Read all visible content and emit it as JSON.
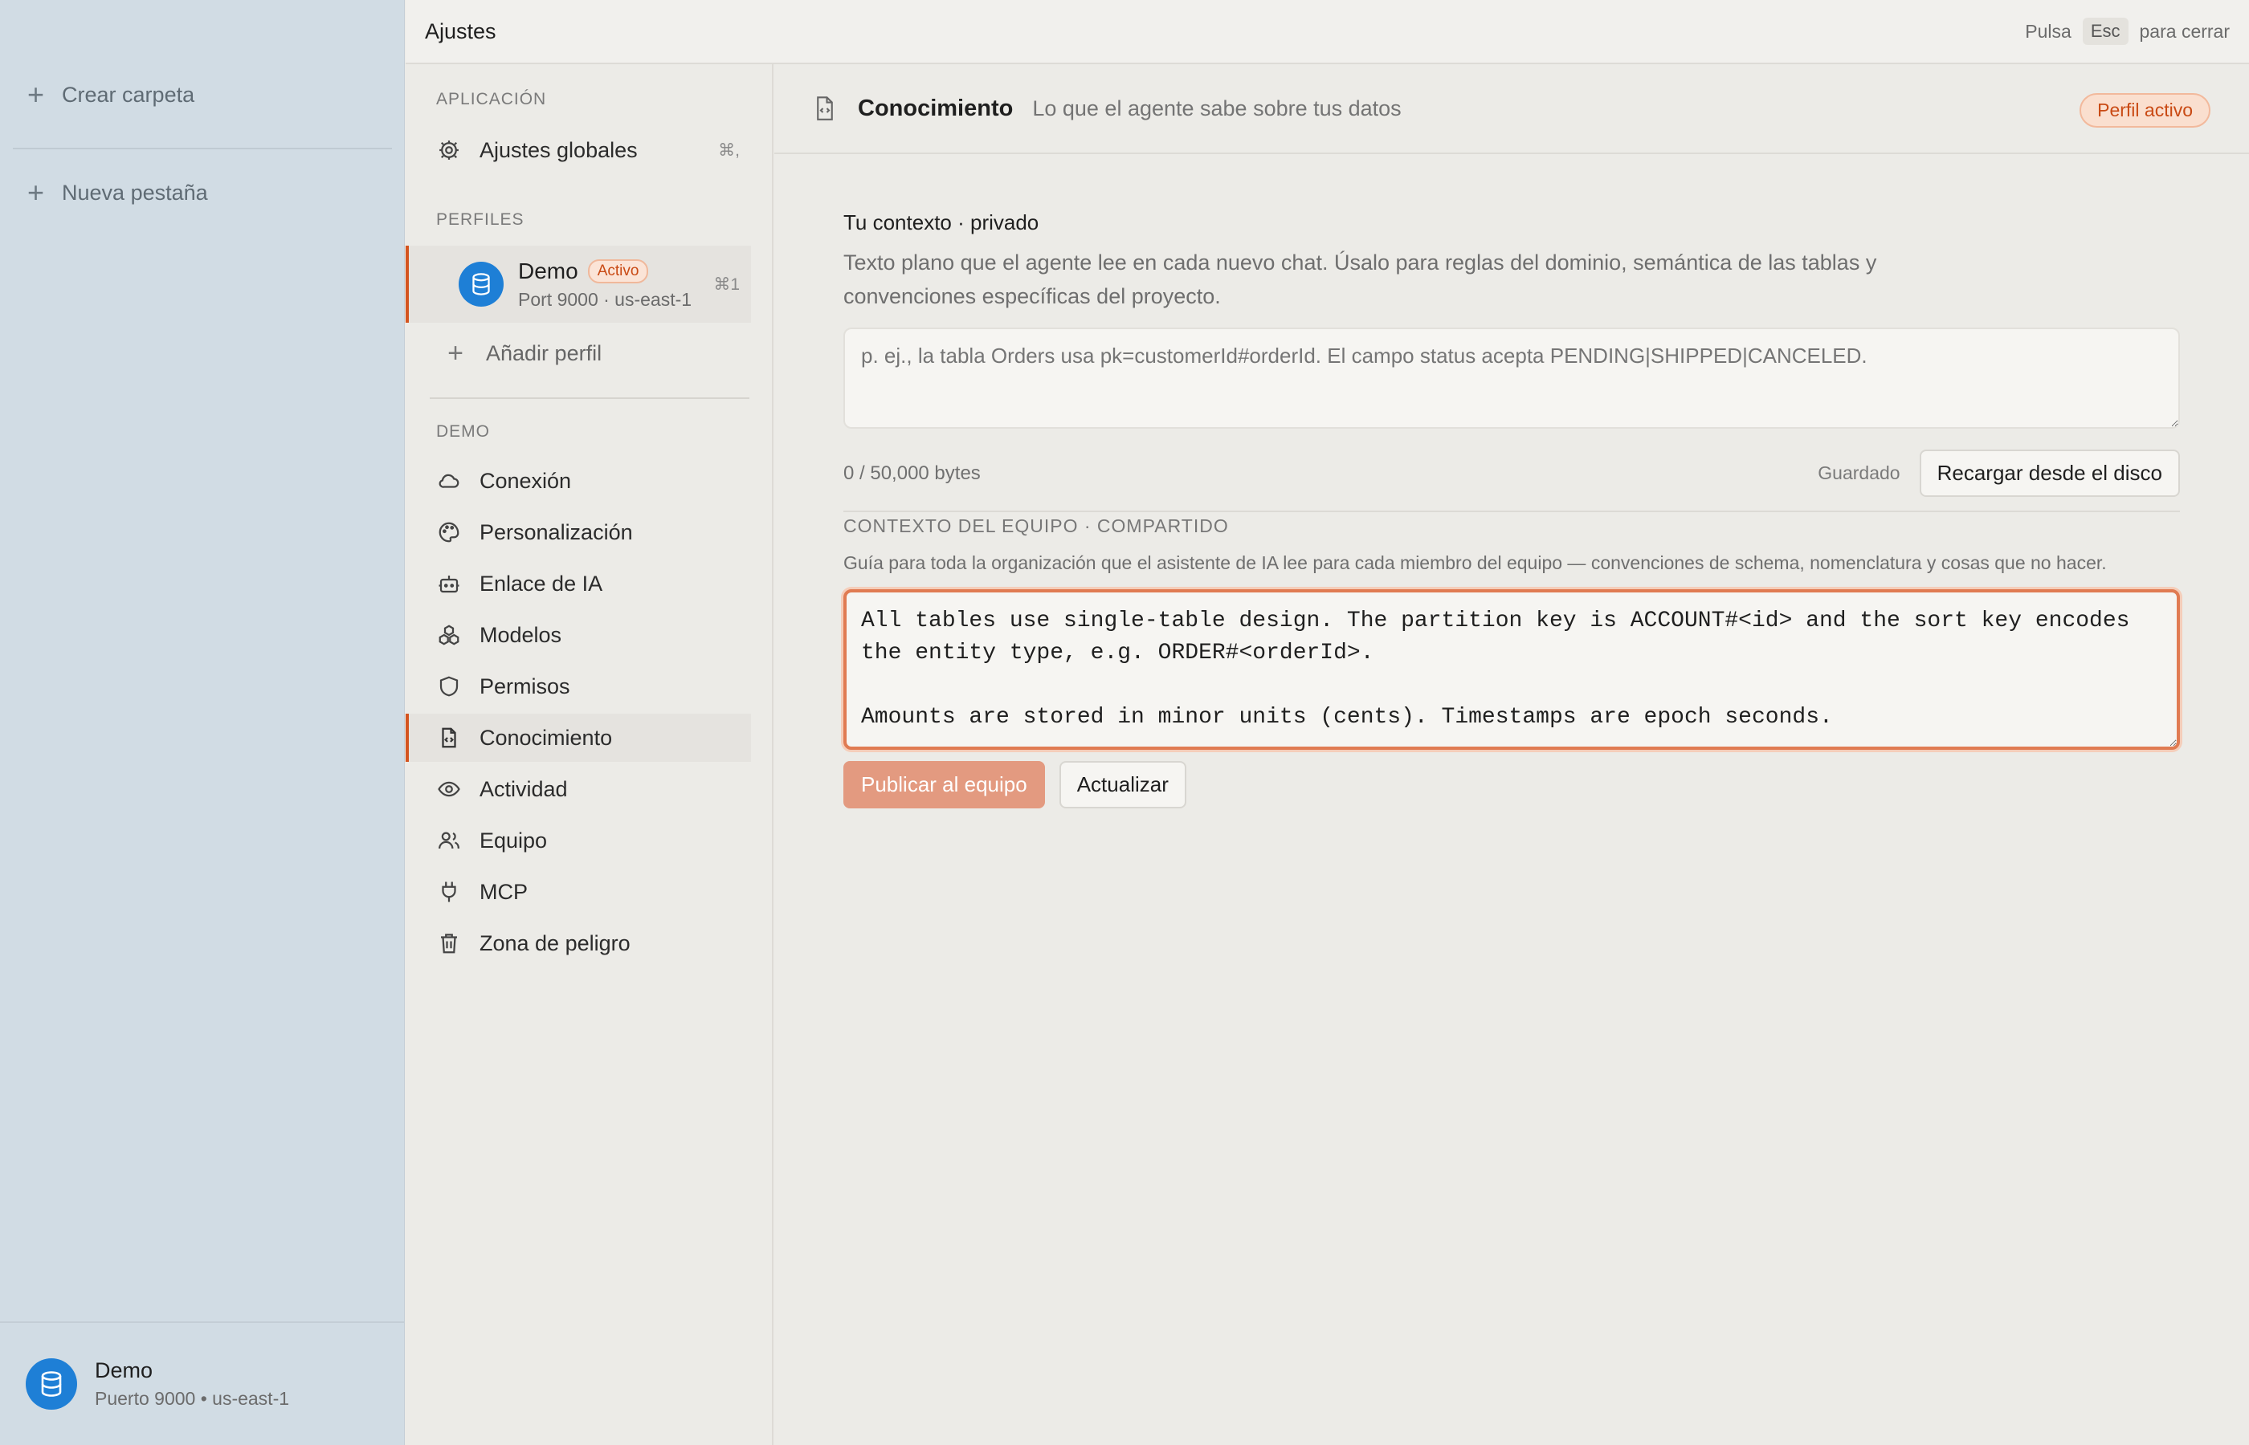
{
  "app_sidebar": {
    "create_folder": "Crear carpeta",
    "new_tab": "Nueva pestaña",
    "footer": {
      "name": "Demo",
      "sub": "Puerto 9000 • us-east-1"
    }
  },
  "topbar": {
    "title": "Ajustes",
    "hint_prefix": "Pulsa",
    "hint_key": "Esc",
    "hint_suffix": "para cerrar"
  },
  "nav": {
    "section_app": "APLICACIÓN",
    "global_settings": {
      "label": "Ajustes globales",
      "shortcut": "⌘,"
    },
    "section_profiles": "PERFILES",
    "profile": {
      "name": "Demo",
      "badge": "Activo",
      "sub": "Port 9000 · us-east-1",
      "shortcut": "⌘1"
    },
    "add_profile": "Añadir perfil",
    "section_demo": "DEMO",
    "items": [
      {
        "label": "Conexión"
      },
      {
        "label": "Personalización"
      },
      {
        "label": "Enlace de IA"
      },
      {
        "label": "Modelos"
      },
      {
        "label": "Permisos"
      },
      {
        "label": "Conocimiento"
      },
      {
        "label": "Actividad"
      },
      {
        "label": "Equipo"
      },
      {
        "label": "MCP"
      },
      {
        "label": "Zona de peligro"
      }
    ]
  },
  "main": {
    "title": "Conocimiento",
    "subtitle": "Lo que el agente sabe sobre tus datos",
    "profile_badge": "Perfil activo",
    "private": {
      "label": "Tu contexto · privado",
      "description": "Texto plano que el agente lee en cada nuevo chat. Úsalo para reglas del dominio, semántica de las tablas y convenciones específicas del proyecto.",
      "placeholder": "p. ej., la tabla Orders usa pk=customerId#orderId. El campo status acepta PENDING|SHIPPED|CANCELED.",
      "bytes": "0 / 50,000 bytes",
      "saved": "Guardado",
      "reload_button": "Recargar desde el disco"
    },
    "team": {
      "label": "CONTEXTO DEL EQUIPO · COMPARTIDO",
      "description": "Guía para toda la organización que el asistente de IA lee para cada miembro del equipo — convenciones de schema, nomenclatura y cosas que no hacer.",
      "value": "All tables use single-table design. The partition key is ACCOUNT#<id> and the sort key encodes\nthe entity type, e.g. ORDER#<orderId>.\n\nAmounts are stored in minor units (cents). Timestamps are epoch seconds.",
      "publish_button": "Publicar al equipo",
      "update_button": "Actualizar"
    }
  },
  "colors": {
    "accent": "#d4541f",
    "db_avatar": "#1e7fd6",
    "app_sidebar_bg": "#d1dce4"
  }
}
